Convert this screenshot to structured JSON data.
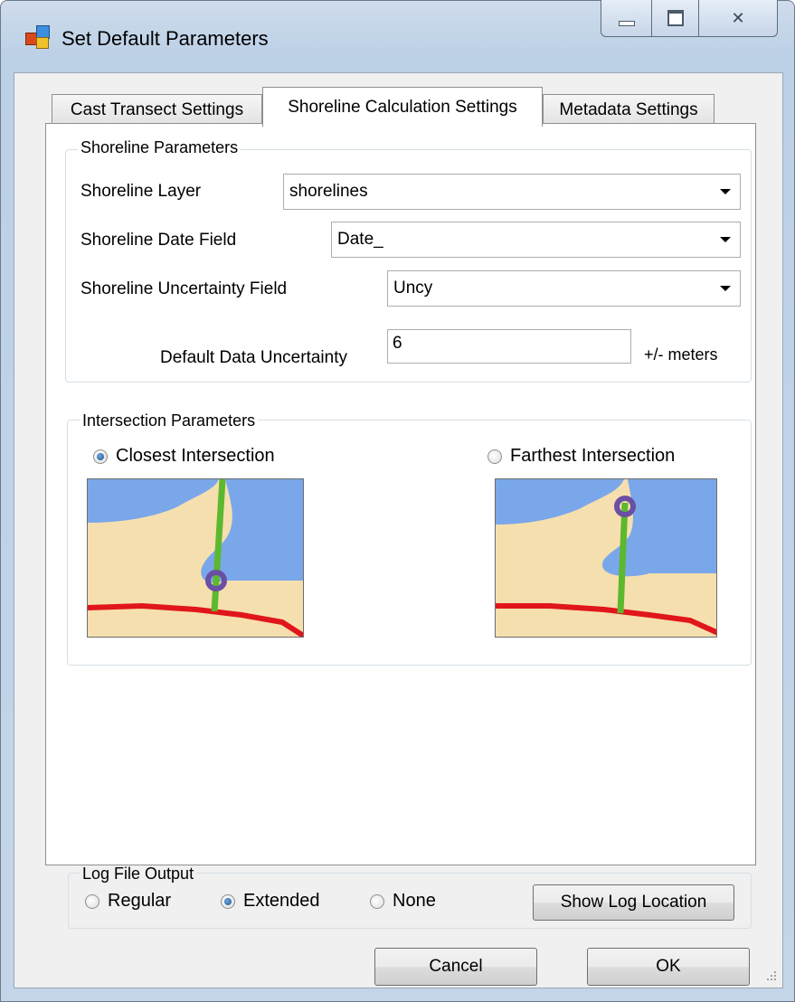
{
  "window": {
    "title": "Set Default Parameters"
  },
  "caption_buttons": {
    "close": "✕"
  },
  "tabs": [
    {
      "label": "Cast Transect Settings",
      "active": false
    },
    {
      "label": "Shoreline Calculation Settings",
      "active": true
    },
    {
      "label": "Metadata Settings",
      "active": false
    }
  ],
  "shoreline_parameters": {
    "group_label": "Shoreline Parameters",
    "layer": {
      "label": "Shoreline Layer",
      "value": "shorelines"
    },
    "date_field": {
      "label": "Shoreline Date Field",
      "value": "Date_"
    },
    "uncertainty_field": {
      "label": "Shoreline Uncertainty Field",
      "value": "Uncy"
    },
    "default_uncertainty": {
      "label": "Default Data Uncertainty",
      "value": "6",
      "unit": "+/- meters"
    }
  },
  "intersection_parameters": {
    "group_label": "Intersection Parameters",
    "closest": {
      "label": "Closest Intersection",
      "checked": true
    },
    "farthest": {
      "label": "Farthest Intersection",
      "checked": false
    }
  },
  "log_file_output": {
    "group_label": "Log File Output",
    "options": [
      {
        "label": "Regular",
        "checked": false
      },
      {
        "label": "Extended",
        "checked": true
      },
      {
        "label": "None",
        "checked": false
      }
    ],
    "show_log_button": "Show Log Location"
  },
  "footer": {
    "cancel": "Cancel",
    "ok": "OK"
  },
  "colors": {
    "water": "#7aa7ea",
    "sand": "#f6dfae",
    "shoreline": "#e0161a",
    "transect": "#5cb82e",
    "intersection": "#6a4fa3"
  }
}
